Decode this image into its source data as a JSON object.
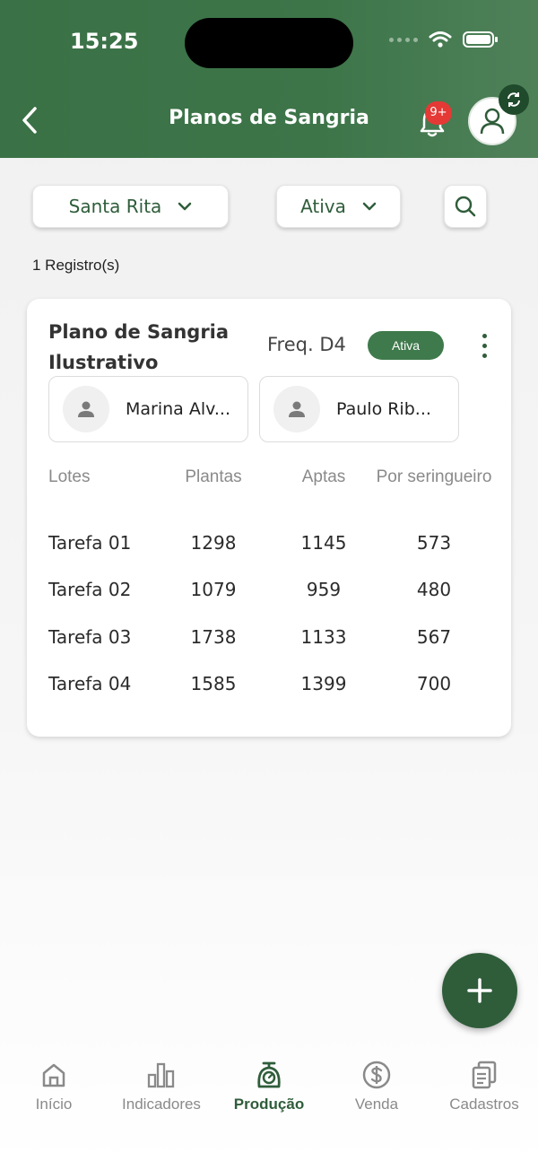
{
  "status_bar": {
    "time": "15:25"
  },
  "header": {
    "title": "Planos de Sangria",
    "notification_badge": "9+"
  },
  "filters": {
    "farm": "Santa Rita",
    "status": "Ativa"
  },
  "record_count": "1 Registro(s)",
  "plan": {
    "name": "Plano de Sangria Ilustrativo",
    "frequency": "Freq. D4",
    "status": "Ativa",
    "workers": [
      "Marina Alv...",
      "Paulo Rib..."
    ],
    "table": {
      "columns": [
        "Lotes",
        "Plantas",
        "Aptas",
        "Por seringueiro"
      ],
      "rows": [
        [
          "Tarefa 01",
          "1298",
          "1145",
          "573"
        ],
        [
          "Tarefa 02",
          "1079",
          "959",
          "480"
        ],
        [
          "Tarefa 03",
          "1738",
          "1133",
          "567"
        ],
        [
          "Tarefa 04",
          "1585",
          "1399",
          "700"
        ]
      ]
    }
  },
  "bottom_nav": [
    {
      "label": "Início",
      "icon": "home-icon",
      "active": false
    },
    {
      "label": "Indicadores",
      "icon": "bar-chart-icon",
      "active": false
    },
    {
      "label": "Produção",
      "icon": "scale-icon",
      "active": true
    },
    {
      "label": "Venda",
      "icon": "dollar-icon",
      "active": false
    },
    {
      "label": "Cadastros",
      "icon": "documents-icon",
      "active": false
    }
  ],
  "colors": {
    "primary": "#2f5d3a",
    "header": "#3a7146",
    "badge": "#e53935",
    "status_active": "#3f7a4c"
  }
}
